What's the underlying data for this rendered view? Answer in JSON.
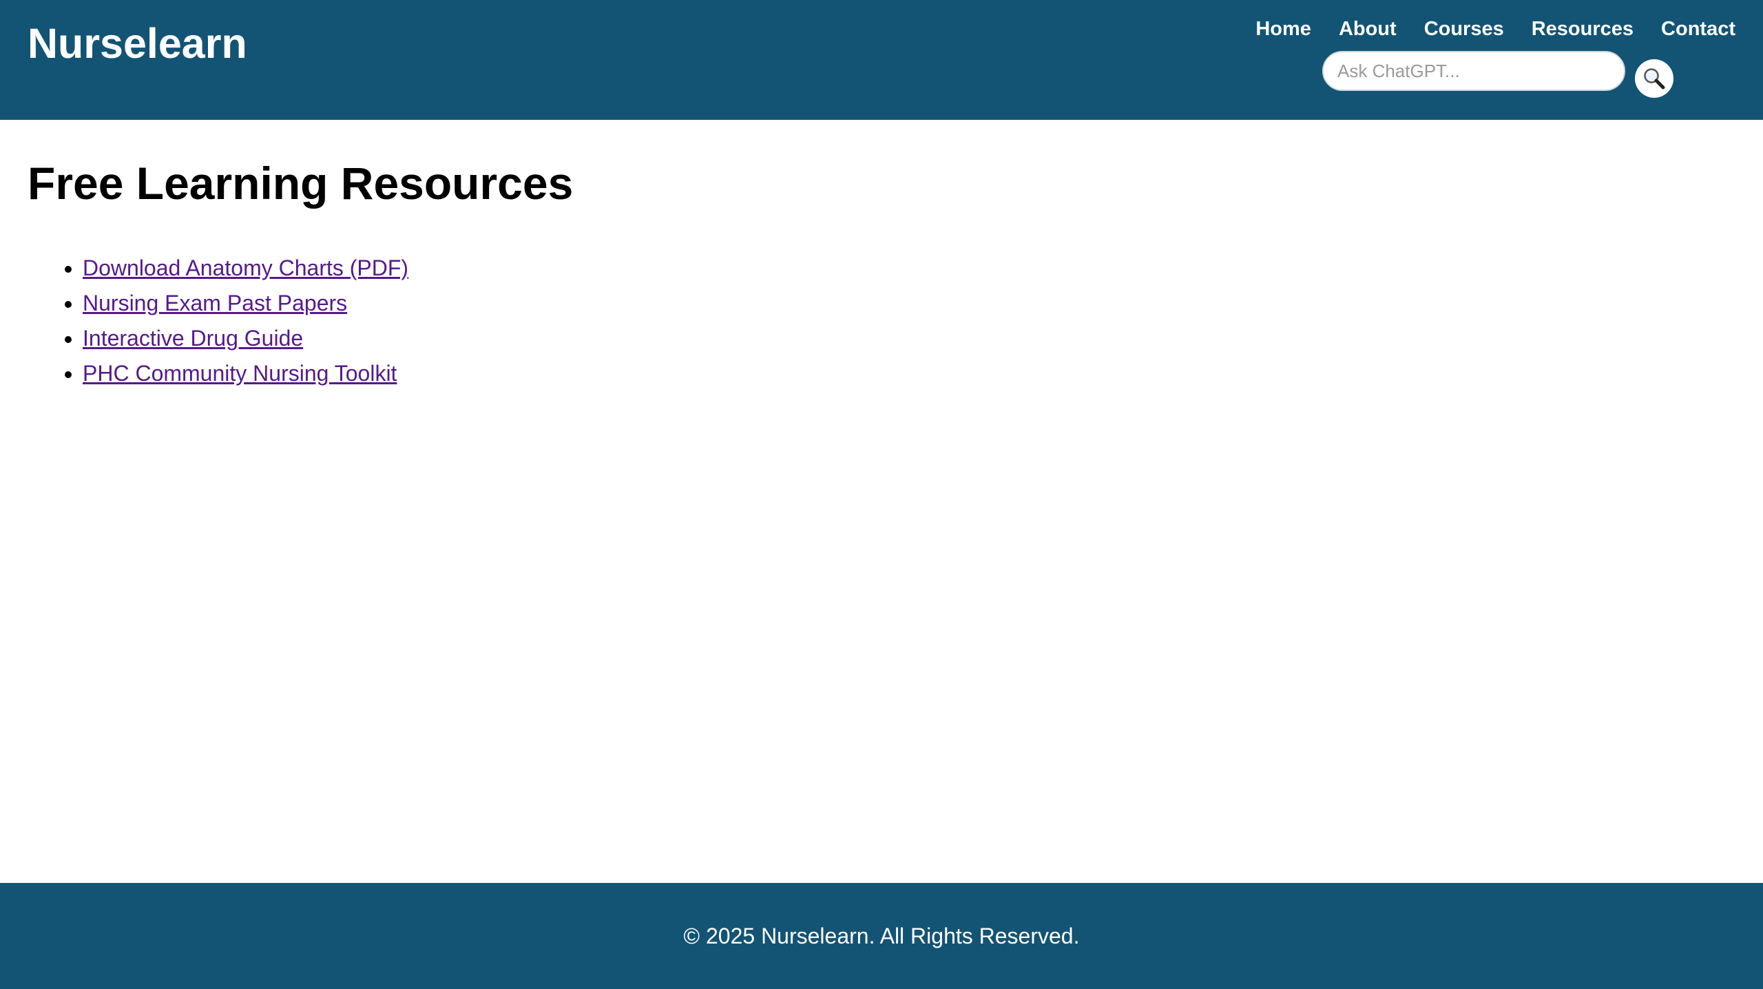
{
  "header": {
    "logo": "Nurselearn",
    "nav": [
      {
        "label": "Home"
      },
      {
        "label": "About"
      },
      {
        "label": "Courses"
      },
      {
        "label": "Resources"
      },
      {
        "label": "Contact"
      }
    ],
    "search": {
      "placeholder": "Ask ChatGPT...",
      "value": "",
      "button_icon": "search-icon"
    }
  },
  "main": {
    "title": "Free Learning Resources",
    "resources": [
      {
        "label": "Download Anatomy Charts (PDF)"
      },
      {
        "label": "Nursing Exam Past Papers"
      },
      {
        "label": "Interactive Drug Guide"
      },
      {
        "label": "PHC Community Nursing Toolkit"
      }
    ]
  },
  "footer": {
    "text": "© 2025 Nurselearn. All Rights Reserved."
  },
  "colors": {
    "brand": "#135475",
    "visited_link": "#551a8b",
    "text": "#000000",
    "header_text": "#ffffff"
  }
}
